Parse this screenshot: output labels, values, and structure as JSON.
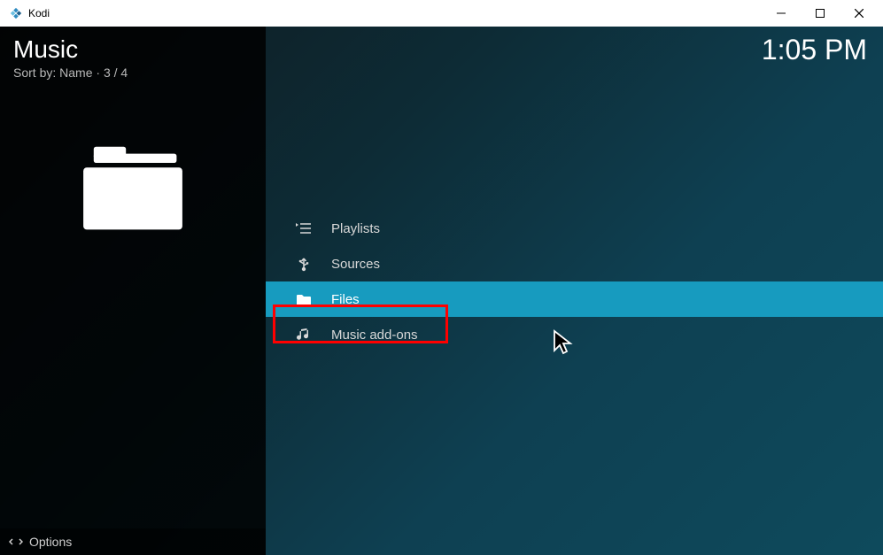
{
  "window": {
    "title": "Kodi",
    "fragment": ""
  },
  "header": {
    "title": "Music",
    "sort_prefix": "Sort by: ",
    "sort_value": "Name",
    "separator": " · ",
    "count": "3 / 4"
  },
  "time": "1:05 PM",
  "menu": {
    "items": [
      {
        "label": "Playlists",
        "icon": "playlist-icon",
        "selected": false
      },
      {
        "label": "Sources",
        "icon": "usb-icon",
        "selected": false
      },
      {
        "label": "Files",
        "icon": "folder-icon",
        "selected": true
      },
      {
        "label": "Music add-ons",
        "icon": "music-icon",
        "selected": false
      }
    ]
  },
  "footer": {
    "options_label": "Options"
  },
  "highlight_color": "#ff0000",
  "selection_color": "#179bbf"
}
